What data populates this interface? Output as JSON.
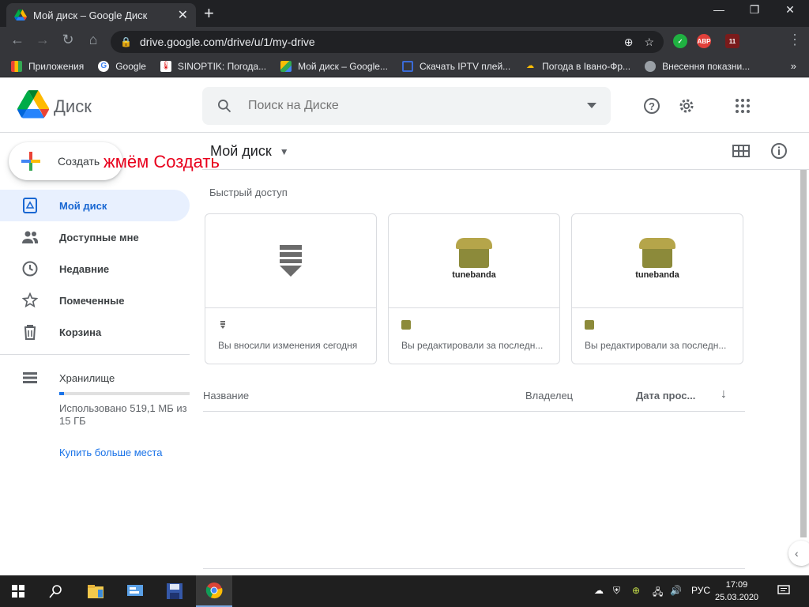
{
  "browser": {
    "tab_title": "Мой диск – Google Диск",
    "new_tab": "+",
    "url": "drive.google.com/drive/u/1/my-drive",
    "window_controls": [
      "—",
      "❐",
      "✕"
    ],
    "extensions": [
      {
        "label": "",
        "color": "#1fb141"
      },
      {
        "label": "ABP",
        "color": "#e0403a"
      },
      {
        "label": "11",
        "color": "#7a1b1b"
      }
    ]
  },
  "bookmarks": [
    {
      "label": "Приложения",
      "icon": "apps-icon"
    },
    {
      "label": "Google",
      "icon": "google-icon"
    },
    {
      "label": "SINOPTIK: Погода...",
      "icon": "sinoptik-icon"
    },
    {
      "label": "Мой диск – Google...",
      "icon": "drive-icon"
    },
    {
      "label": "Скачать IPTV плей...",
      "icon": "tv-icon"
    },
    {
      "label": "Погода в Івано-Фр...",
      "icon": "weather-icon"
    },
    {
      "label": "Внесення показни...",
      "icon": "globe-icon"
    }
  ],
  "drive": {
    "logo_text": "Диск",
    "search_placeholder": "Поиск на Диске",
    "create_label": "Создать",
    "annotation": "жмём Создать",
    "sidebar": [
      {
        "label": "Мой диск",
        "icon": "my-drive-icon",
        "active": true
      },
      {
        "label": "Доступные мне",
        "icon": "shared-icon"
      },
      {
        "label": "Недавние",
        "icon": "recent-icon"
      },
      {
        "label": "Помеченные",
        "icon": "starred-icon"
      },
      {
        "label": "Корзина",
        "icon": "trash-icon"
      }
    ],
    "storage": {
      "label": "Хранилище",
      "used_text": "Использовано 519,1 МБ из 15 ГБ",
      "used_fraction": 0.034,
      "buy_link": "Купить больше места"
    },
    "main_title": "Мой диск",
    "quick_access_label": "Быстрый доступ",
    "cards": [
      {
        "text": "Вы вносили изменения сегодня",
        "thumb": "download-icon"
      },
      {
        "text": "Вы редактировали за последн...",
        "thumb": "tunebanda",
        "brand": "tunebanda"
      },
      {
        "text": "Вы редактировали за последн...",
        "thumb": "tunebanda",
        "brand": "tunebanda"
      }
    ],
    "columns": {
      "name": "Название",
      "owner": "Владелец",
      "date": "Дата прос..."
    }
  },
  "taskbar": {
    "language": "РУС",
    "time": "17:09",
    "date": "25.03.2020"
  },
  "colors": {
    "accent": "#1a73e8",
    "active_bg": "#e8f0fe",
    "annotation": "#e8001c"
  }
}
